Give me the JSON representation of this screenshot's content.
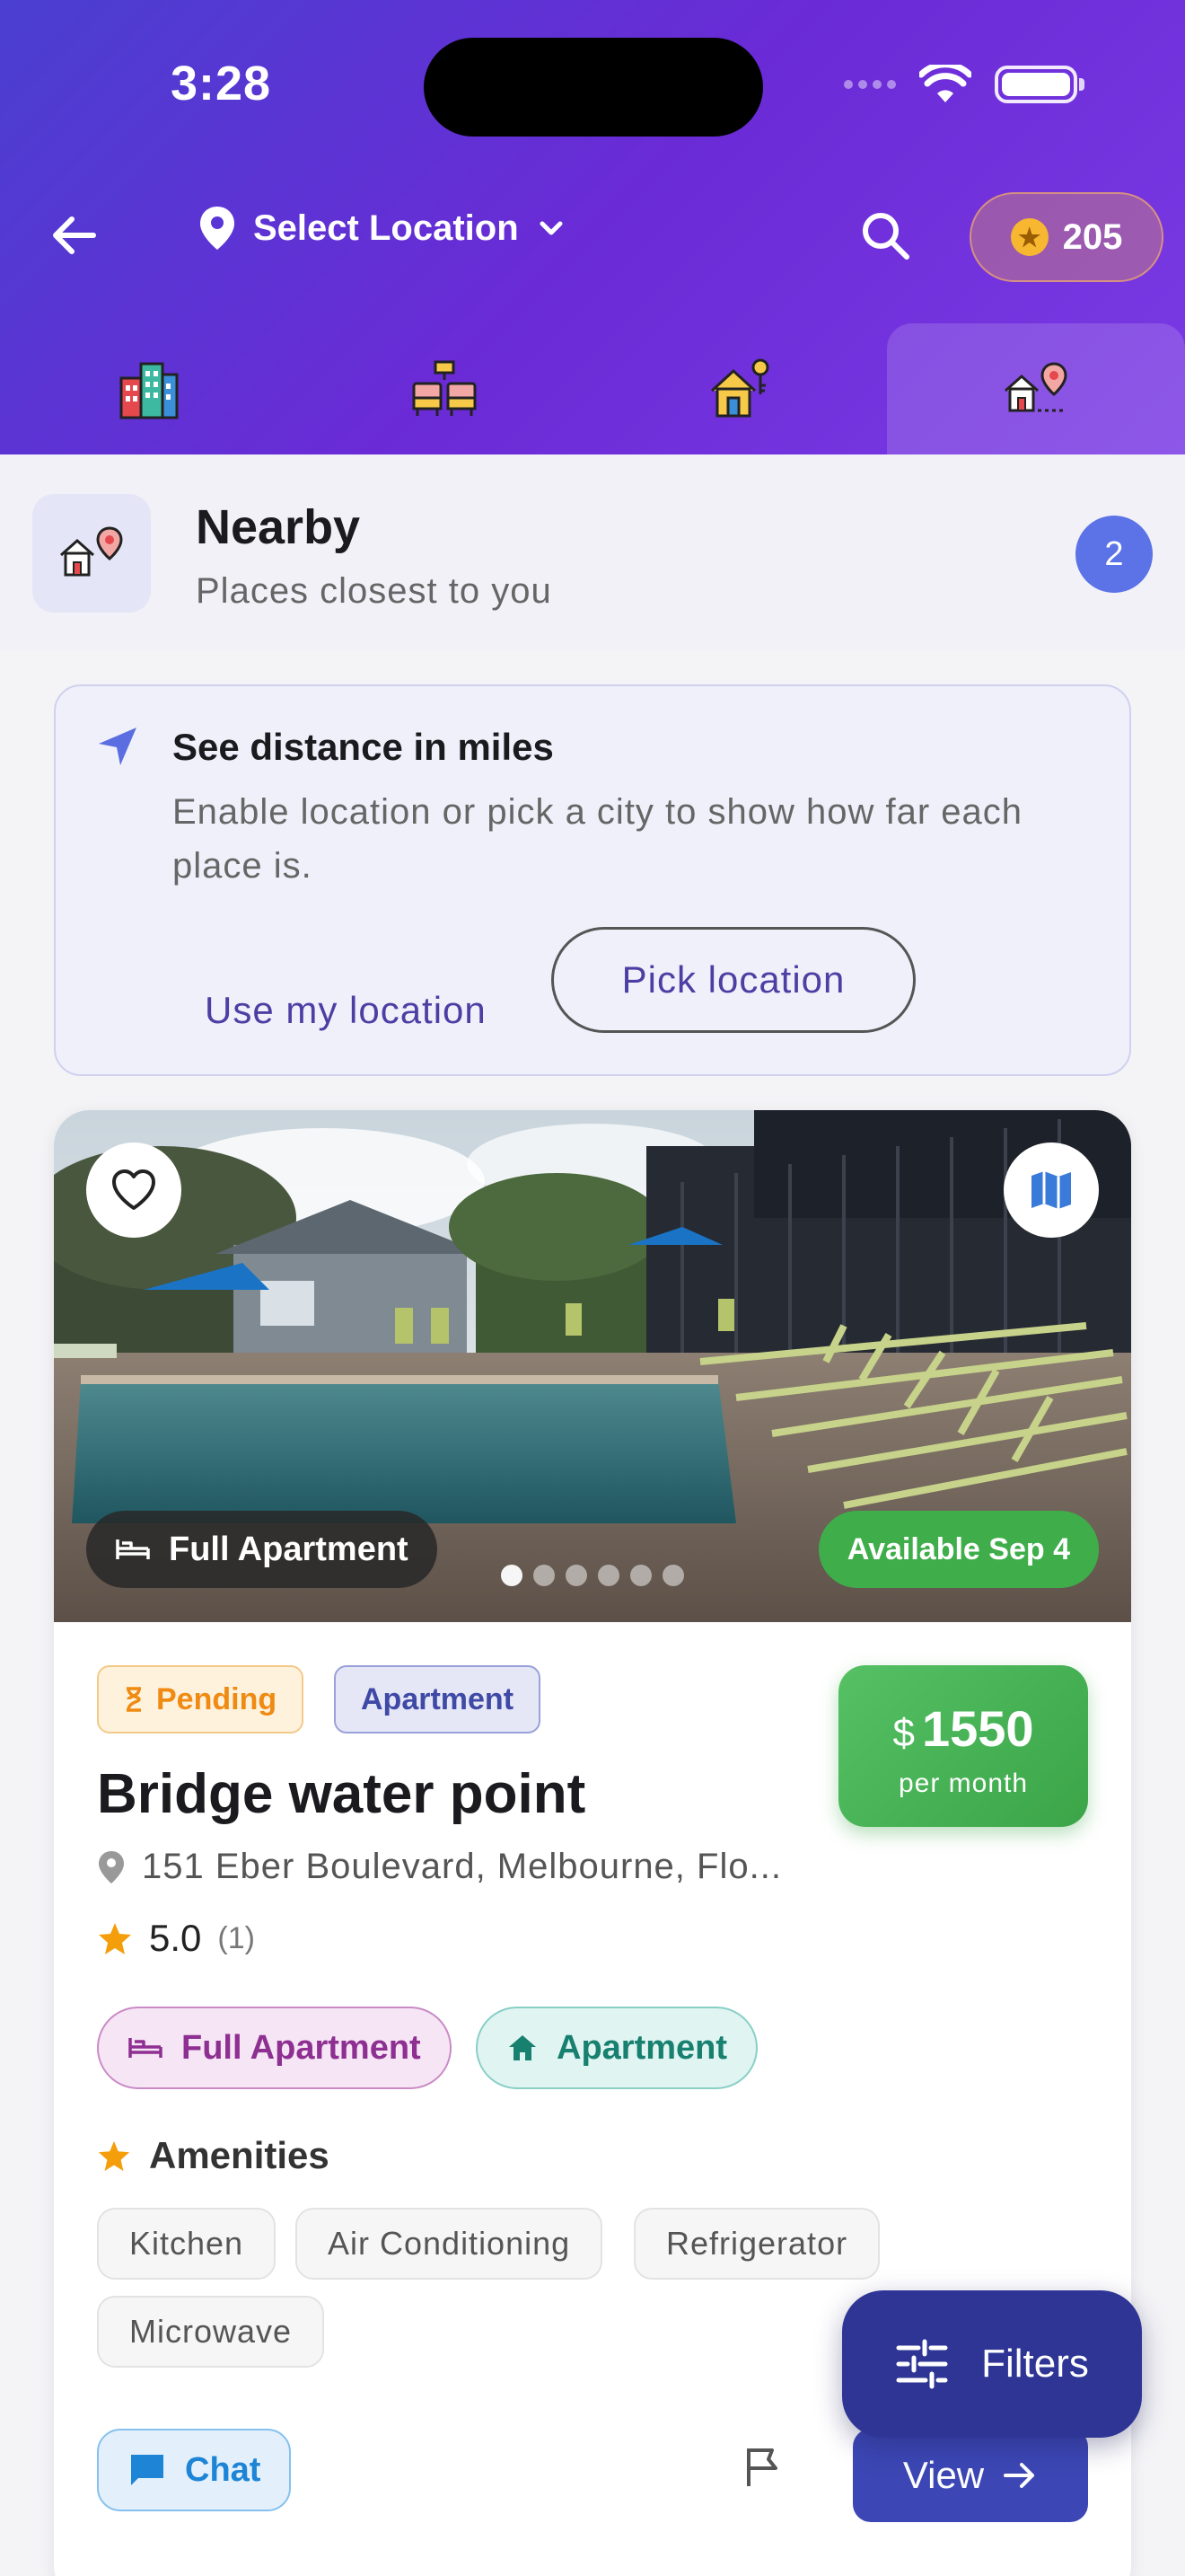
{
  "status": {
    "time": "3:28"
  },
  "header": {
    "location_label": "Select Location",
    "coins": "205",
    "categories": [
      "city-buildings-icon",
      "hotel-beds-icon",
      "house-key-icon",
      "nearby-home-pin-icon"
    ]
  },
  "nearby": {
    "title": "Nearby",
    "subtitle": "Places closest to you",
    "count": "2"
  },
  "notice": {
    "title": "See distance in miles",
    "body": "Enable location or pick a city to show how far each place is.",
    "use_location": "Use my location",
    "pick_location": "Pick location"
  },
  "listing": {
    "type_chip": "Full Apartment",
    "availability": "Available Sep 4",
    "status_badge": "Pending",
    "category_badge": "Apartment",
    "price_currency": "$",
    "price": "1550",
    "price_period": "per month",
    "title": "Bridge water point",
    "address": "151 Eber Boulevard, Melbourne, Flo...",
    "rating": "5.0",
    "rating_count": "(1)",
    "tags": [
      "Full Apartment",
      "Apartment"
    ],
    "amenities_title": "Amenities",
    "amenities": [
      "Kitchen",
      "Air Conditioning",
      "Refrigerator",
      "Microwave"
    ],
    "chat": "Chat",
    "view": "View",
    "photo_count": 6,
    "photo_index": 1
  },
  "fab": {
    "filters": "Filters"
  },
  "colors": {
    "accent": "#4c3fa3",
    "header_start": "#4a3fd0",
    "header_end": "#7a3ae4",
    "available": "#3fae4a",
    "price": "#4caf50",
    "pending": "#ef8a12"
  }
}
